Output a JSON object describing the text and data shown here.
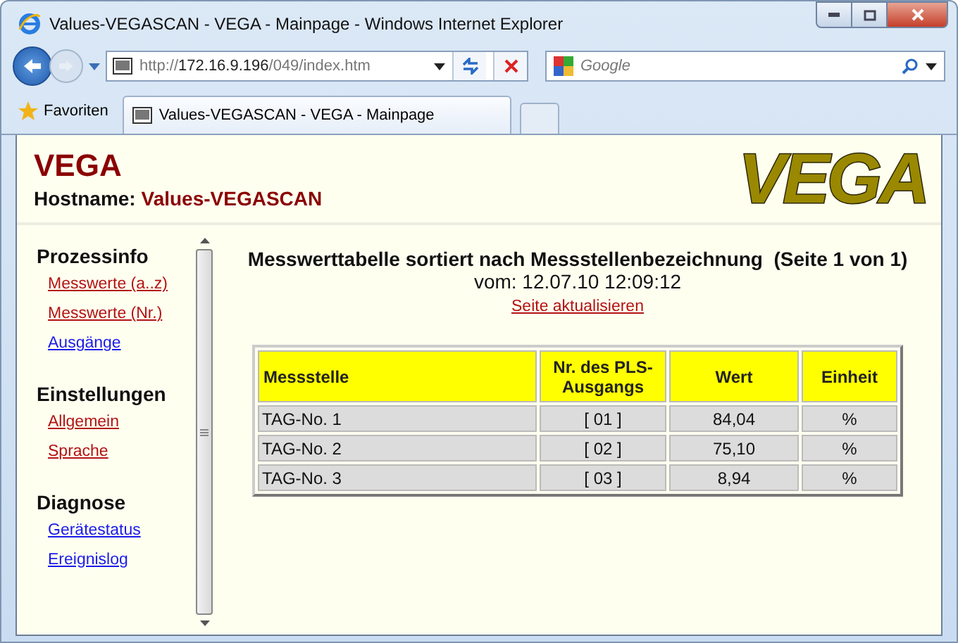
{
  "window": {
    "title": "Values-VEGASCAN - VEGA - Mainpage - Windows Internet Explorer"
  },
  "address_bar": {
    "url_prefix": "http://",
    "url_host": "172.16.9.196",
    "url_path": "/049/index.htm"
  },
  "search": {
    "placeholder": "Google"
  },
  "favorites": {
    "label": "Favoriten"
  },
  "tabs": [
    {
      "label": "Values-VEGASCAN - VEGA - Mainpage",
      "selected": true
    }
  ],
  "header": {
    "title": "VEGA",
    "hostname_label": "Hostname:",
    "hostname": "Values-VEGASCAN",
    "logo": "VEGA"
  },
  "sidebar": {
    "sections": [
      {
        "title": "Prozessinfo",
        "items": [
          {
            "label": "Messwerte (a..z)",
            "visited": true
          },
          {
            "label": "Messwerte (Nr.)",
            "visited": true
          },
          {
            "label": "Ausgänge",
            "visited": false
          }
        ]
      },
      {
        "title": "Einstellungen",
        "items": [
          {
            "label": "Allgemein",
            "visited": true
          },
          {
            "label": "Sprache",
            "visited": true
          }
        ]
      },
      {
        "title": "Diagnose",
        "items": [
          {
            "label": "Gerätestatus",
            "visited": false
          },
          {
            "label": "Ereignislog",
            "visited": false
          }
        ]
      }
    ]
  },
  "main": {
    "heading": "Messwerttabelle sortiert nach Messstellenbezeichnung  (Seite 1 von 1)",
    "date": "vom: 12.07.10 12:09:12",
    "refresh_link": {
      "label": "Seite aktualisieren",
      "visited": true
    }
  },
  "table": {
    "columns": [
      "Messstelle",
      "Nr. des PLS-Ausgangs",
      "Wert",
      "Einheit"
    ],
    "rows": [
      [
        "TAG-No. 1",
        "[ 01 ]",
        "84,04",
        "%"
      ],
      [
        "TAG-No. 2",
        "[ 02 ]",
        "75,10",
        "%"
      ],
      [
        "TAG-No. 3",
        "[ 03 ]",
        "8,94",
        "%"
      ]
    ]
  }
}
